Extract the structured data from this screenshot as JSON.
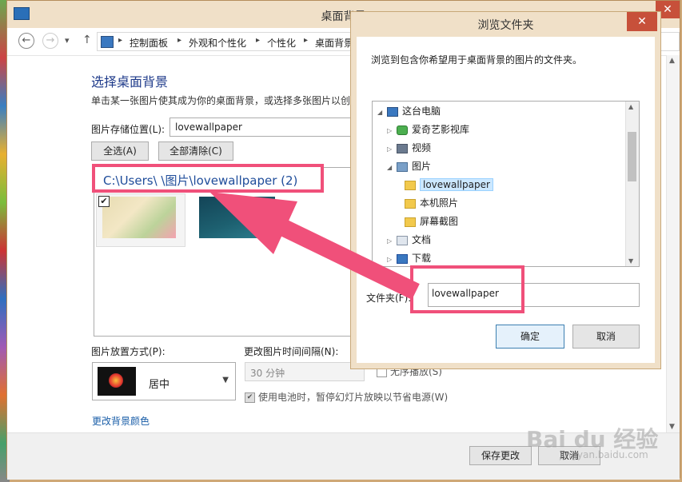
{
  "main_window": {
    "title": "桌面背景",
    "close_glyph": "✕",
    "nav": {
      "back_glyph": "←",
      "forward_glyph": "→",
      "dropdown_glyph": "▾",
      "up_glyph": "↑"
    },
    "breadcrumbs": [
      "控制面板",
      "外观和个性化",
      "个性化",
      "桌面背景"
    ],
    "breadcrumb_sep": "▸",
    "heading": "选择桌面背景",
    "description": "单击某一张图片使其成为你的桌面背景，或选择多张图片以创",
    "location_label": "图片存储位置(L):",
    "location_value": "lovewallpaper",
    "select_all_label": "全选(A)",
    "clear_all_label": "全部清除(C)",
    "folder_path": "C:\\Users\\      \\图片\\lovewallpaper (2)",
    "checked_glyph": "✔",
    "position_label": "图片放置方式(P):",
    "position_value": "居中",
    "interval_label": "更改图片时间间隔(N):",
    "interval_value": "30 分钟",
    "shuffle_label": "无序播放(S)",
    "battery_label": "使用电池时，暂停幻灯片放映以节省电源(W)",
    "color_link": "更改背景颜色",
    "save_label": "保存更改",
    "cancel_label": "取消"
  },
  "dialog": {
    "title": "浏览文件夹",
    "close_glyph": "✕",
    "description": "浏览到包含你希望用于桌面背景的图片的文件夹。",
    "tree": [
      {
        "label": "这台电脑",
        "icon": "computer-icon",
        "expander": "◢"
      },
      {
        "label": "爱奇艺影视库",
        "icon": "iqiyi-icon",
        "expander": "▷"
      },
      {
        "label": "视频",
        "icon": "video-folder-icon",
        "expander": "▷"
      },
      {
        "label": "图片",
        "icon": "pictures-folder-icon",
        "expander": "◢"
      },
      {
        "label": "lovewallpaper",
        "icon": "folder-icon",
        "expander": ""
      },
      {
        "label": "本机照片",
        "icon": "folder-icon",
        "expander": ""
      },
      {
        "label": "屏幕截图",
        "icon": "folder-icon",
        "expander": ""
      },
      {
        "label": "文档",
        "icon": "documents-folder-icon",
        "expander": "▷"
      },
      {
        "label": "下载",
        "icon": "downloads-folder-icon",
        "expander": "▷"
      }
    ],
    "folder_label": "文件夹(F):",
    "folder_value": "lovewallpaper",
    "ok_label": "确定",
    "cancel_label": "取消"
  },
  "watermark": {
    "main": "Bai du 经验",
    "sub": "jingyan.baidu.com"
  },
  "colors": {
    "highlight": "#f0507a",
    "title_text": "#1e3a8a",
    "link": "#1a5ea8",
    "dialog_frame": "#f0e0c8"
  }
}
